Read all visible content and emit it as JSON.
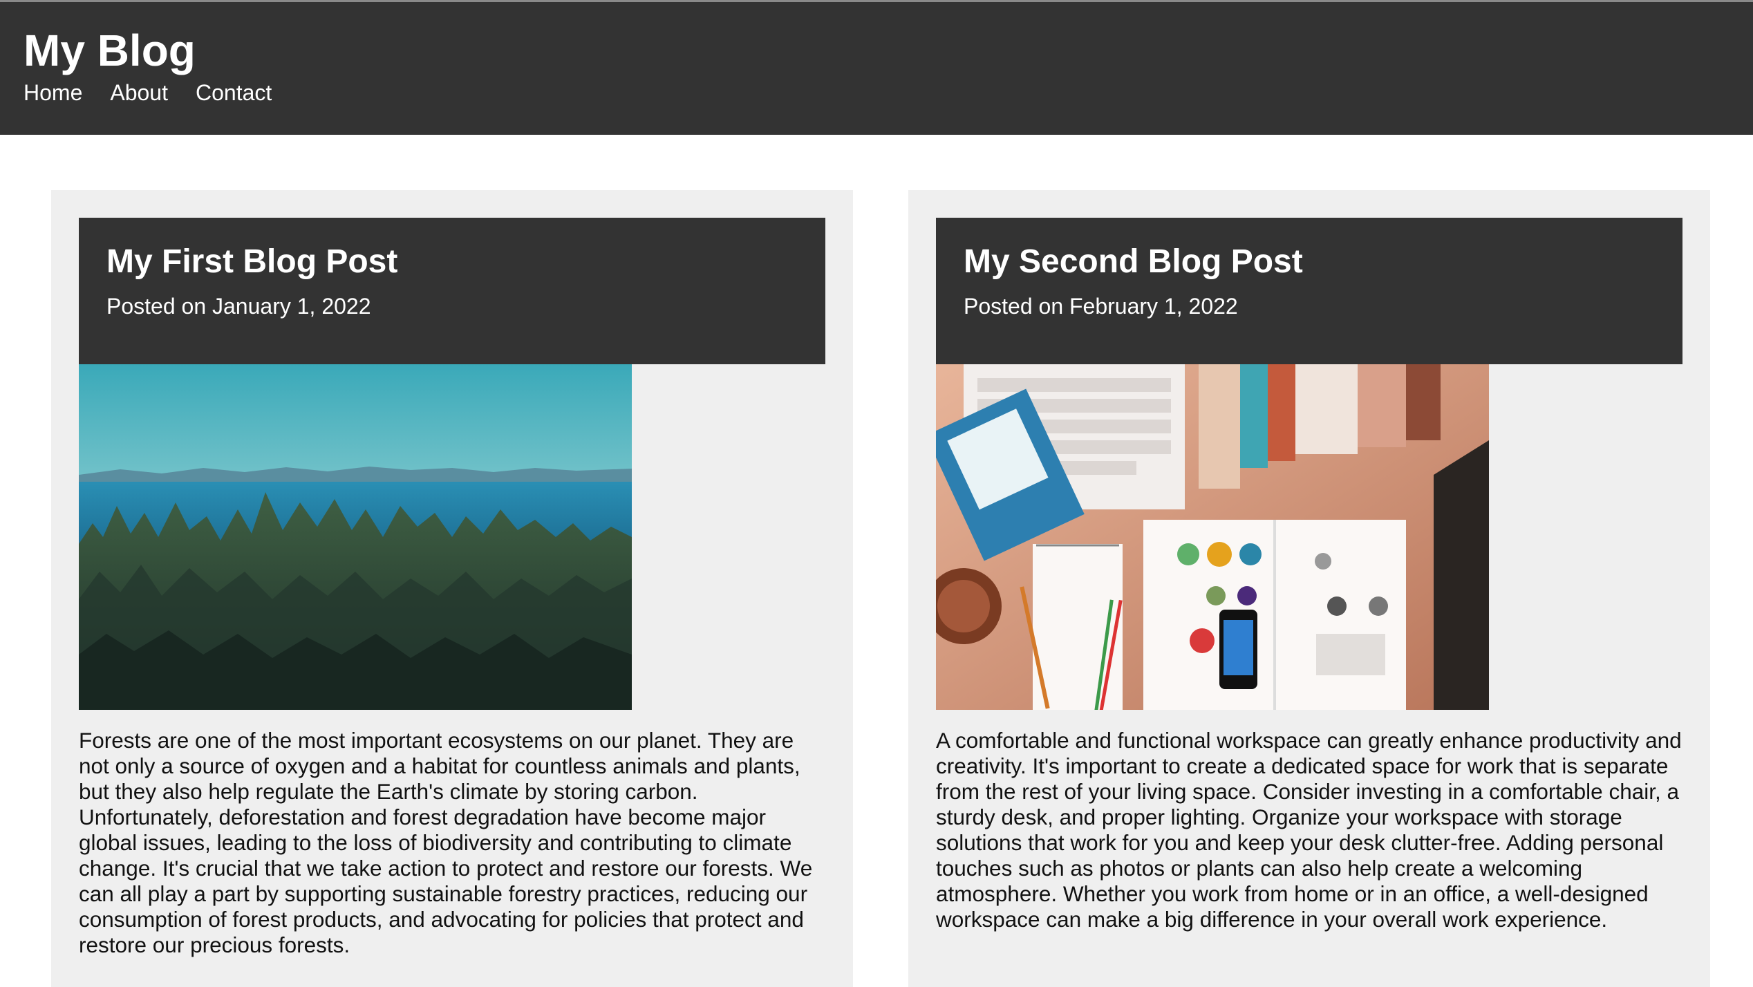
{
  "site": {
    "title": "My Blog"
  },
  "nav": {
    "items": [
      "Home",
      "About",
      "Contact"
    ]
  },
  "posts": [
    {
      "title": "My First Blog Post",
      "date": "Posted on January 1, 2022",
      "image": "forest-lake-photo",
      "body": "Forests are one of the most important ecosystems on our planet. They are not only a source of oxygen and a habitat for countless animals and plants, but they also help regulate the Earth's climate by storing carbon. Unfortunately, deforestation and forest degradation have become major global issues, leading to the loss of biodiversity and contributing to climate change. It's crucial that we take action to protect and restore our forests. We can all play a part by supporting sustainable forestry practices, reducing our consumption of forest products, and advocating for policies that protect and restore our precious forests."
    },
    {
      "title": "My Second Blog Post",
      "date": "Posted on February 1, 2022",
      "image": "desk-workspace-photo",
      "body": "A comfortable and functional workspace can greatly enhance productivity and creativity. It's important to create a dedicated space for work that is separate from the rest of your living space. Consider investing in a comfortable chair, a sturdy desk, and proper lighting. Organize your workspace with storage solutions that work for you and keep your desk clutter-free. Adding personal touches such as photos or plants can also help create a welcoming atmosphere. Whether you work from home or in an office, a well-designed workspace can make a big difference in your overall work experience."
    }
  ],
  "colors": {
    "header_bg": "#333333",
    "card_bg": "#efefef",
    "page_bg": "#ffffff",
    "text": "#111111"
  }
}
